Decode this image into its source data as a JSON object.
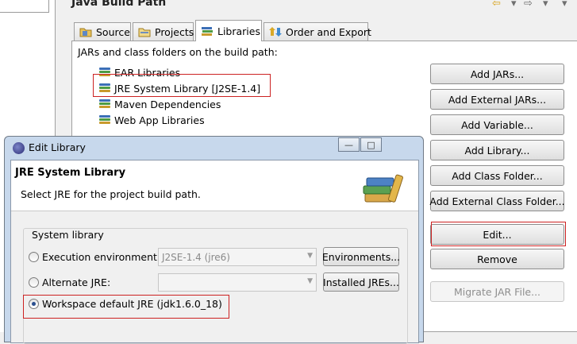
{
  "page": {
    "title": "Java Build Path",
    "nav_back_glyph": "⇦",
    "nav_forward_glyph": "⇨",
    "menu_glyph": "▾"
  },
  "tabs": [
    {
      "label": "Source",
      "icon": "source-folder-icon",
      "active": false
    },
    {
      "label": "Projects",
      "icon": "projects-icon",
      "active": false
    },
    {
      "label": "Libraries",
      "icon": "libraries-icon",
      "active": true
    },
    {
      "label": "Order and Export",
      "icon": "order-export-icon",
      "active": false
    }
  ],
  "libraries": {
    "caption": "JARs and class folders on the build path:",
    "items": [
      {
        "label": "EAR Libraries",
        "icon": "library-icon"
      },
      {
        "label": "JRE System Library [J2SE-1.4]",
        "icon": "library-icon",
        "selected": true
      },
      {
        "label": "Maven Dependencies",
        "icon": "library-icon"
      },
      {
        "label": "Web App Libraries",
        "icon": "library-icon"
      }
    ]
  },
  "buttons": {
    "add_jars": "Add JARs...",
    "add_external_jars": "Add External JARs...",
    "add_variable": "Add Variable...",
    "add_library": "Add Library...",
    "add_class_folder": "Add Class Folder...",
    "add_external_class_folder": "Add External Class Folder...",
    "edit": "Edit...",
    "remove": "Remove",
    "migrate_jar": "Migrate JAR File..."
  },
  "dialog": {
    "title": "Edit Library",
    "header_title": "JRE System Library",
    "header_message": "Select JRE for the project build path.",
    "group_label": "System library",
    "options": {
      "execution_env": {
        "label": "Execution environment:",
        "combo_value": "J2SE-1.4 (jre6)",
        "button": "Environments..."
      },
      "alternate_jre": {
        "label": "Alternate JRE:",
        "combo_value": "",
        "button": "Installed JREs..."
      },
      "workspace_default": {
        "label": "Workspace default JRE (jdk1.6.0_18)",
        "selected": true
      }
    },
    "title_buttons": {
      "minimize": "—",
      "maximize": "□"
    }
  },
  "colors": {
    "highlight_box": "#cc2222",
    "dialog_frame": "#c7d8ec"
  }
}
